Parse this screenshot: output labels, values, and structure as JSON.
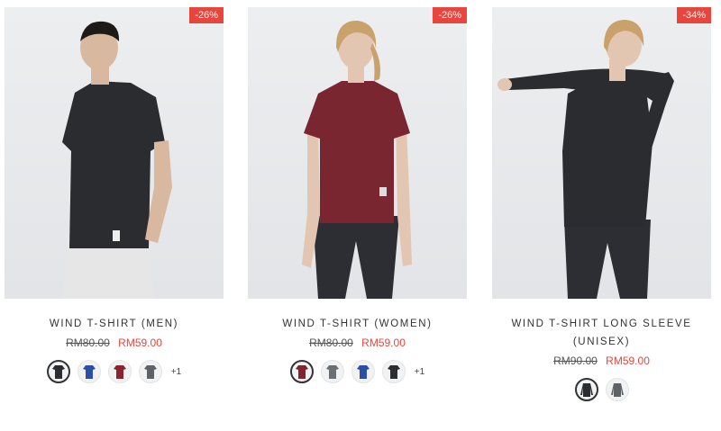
{
  "products": [
    {
      "discount": "-26%",
      "title": "WIND T-SHIRT (MEN)",
      "old_price": "RM80.00",
      "new_price": "RM59.00",
      "more_colors": "+1",
      "swatch_colors": [
        "#2b2d31",
        "#2a4fa3",
        "#8a2430",
        "#5e6166"
      ]
    },
    {
      "discount": "-26%",
      "title": "WIND T-SHIRT (WOMEN)",
      "old_price": "RM80.00",
      "new_price": "RM59.00",
      "more_colors": "+1",
      "swatch_colors": [
        "#7d2630",
        "#6b6e72",
        "#2a4fa3",
        "#2b2d31"
      ]
    },
    {
      "discount": "-34%",
      "title_line1": "WIND T-SHIRT LONG SLEEVE",
      "title_line2": "(UNISEX)",
      "old_price": "RM90.00",
      "new_price": "RM59.00",
      "swatch_colors": [
        "#2b2d31",
        "#5e6166"
      ]
    }
  ],
  "colors": {
    "accent": "#e8453c"
  }
}
